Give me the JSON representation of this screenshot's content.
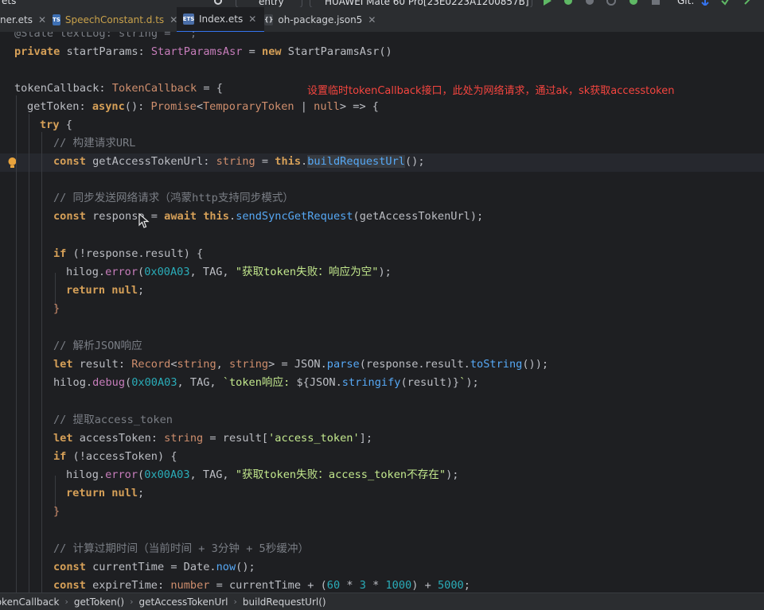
{
  "toolbar": {
    "left_fragment": "ets",
    "run_config": "entry",
    "device": "HUAWEI Mate 60 Pro[23E0223A1200857B]",
    "git_label": "Git:"
  },
  "tabs": [
    {
      "label": "ner.ets",
      "icon": "ets-file-icon",
      "active": false,
      "modified": false
    },
    {
      "label": "SpeechConstant.d.ts",
      "icon": "ts-file-icon",
      "active": false,
      "modified": true
    },
    {
      "label": "Index.ets",
      "icon": "ets-file-icon",
      "active": true,
      "modified": false
    },
    {
      "label": "oh-package.json5",
      "icon": "json-file-icon",
      "active": false,
      "modified": false
    }
  ],
  "annotation": "设置临时tokenCallback接口，此处为网络请求，通过ak，sk获取accesstoken",
  "code": {
    "l0": "@State textLog: string = '';",
    "l1a": "private",
    "l1b": " startParams: ",
    "l1c": "StartParamsAsr",
    "l1d": " = ",
    "l1e": "new",
    "l1f": " StartParamsAsr()",
    "l3a": "tokenCallback: ",
    "l3b": "TokenCallback",
    "l3c": " = {",
    "l4a": "getToken: ",
    "l4b": "async",
    "l4c": "(): ",
    "l4d": "Promise",
    "l4e": "<",
    "l4f": "TemporaryToken",
    "l4g": " | ",
    "l4h": "null",
    "l4i": "> => {",
    "l5a": "try",
    "l5b": " {",
    "l6": "// 构建请求URL",
    "l7a": "const",
    "l7b": " getAccessTokenUrl: ",
    "l7c": "string",
    "l7d": " = ",
    "l7e": "this",
    "l7f": ".",
    "l7g": "buildRequestUrl",
    "l7h": "();",
    "l9": "// 同步发送网络请求（鸿蒙http支持同步模式）",
    "l10a": "const",
    "l10b": " response = ",
    "l10c": "await",
    "l10d": " ",
    "l10e": "this",
    "l10f": ".",
    "l10g": "sendSyncGetRequest",
    "l10h": "(getAccessTokenUrl);",
    "l12a": "if",
    "l12b": " (!response.result) {",
    "l13a": "hilog.",
    "l13b": "error",
    "l13c": "(",
    "l13d": "0x00A03",
    "l13e": ", TAG, ",
    "l13f": "\"获取token失败：响应为空\"",
    "l13g": ");",
    "l14a": "return",
    "l14b": " ",
    "l14c": "null",
    "l14d": ";",
    "l15": "}",
    "l17": "// 解析JSON响应",
    "l18a": "let",
    "l18b": " result: ",
    "l18c": "Record",
    "l18d": "<",
    "l18e": "string",
    "l18f": ", ",
    "l18g": "string",
    "l18h": "> = JSON.",
    "l18i": "parse",
    "l18j": "(response.result.",
    "l18k": "toString",
    "l18l": "());",
    "l19a": "hilog.",
    "l19b": "debug",
    "l19c": "(",
    "l19d": "0x00A03",
    "l19e": ", TAG, ",
    "l19f": "`token响应: ",
    "l19g": "${JSON.",
    "l19h": "stringify",
    "l19i": "(result)}",
    "l19j": "`",
    "l19k": ");",
    "l21": "// 提取access_token",
    "l22a": "let",
    "l22b": " accessToken: ",
    "l22c": "string",
    "l22d": " = result[",
    "l22e": "'access_token'",
    "l22f": "];",
    "l23a": "if",
    "l23b": " (!accessToken) {",
    "l24a": "hilog.",
    "l24b": "error",
    "l24c": "(",
    "l24d": "0x00A03",
    "l24e": ", TAG, ",
    "l24f": "\"获取token失败：access_token不存在\"",
    "l24g": ");",
    "l25a": "return",
    "l25b": " ",
    "l25c": "null",
    "l25d": ";",
    "l26": "}",
    "l28": "// 计算过期时间（当前时间 + 3分钟 + 5秒缓冲）",
    "l29a": "const",
    "l29b": " currentTime = Date.",
    "l29c": "now",
    "l29d": "();",
    "l30a": "const",
    "l30b": " expireTime: ",
    "l30c": "number",
    "l30d": " = currentTime + (",
    "l30e": "60",
    "l30f": " * ",
    "l30g": "3",
    "l30h": " * ",
    "l30i": "1000",
    "l30j": ") + ",
    "l30k": "5000",
    "l30l": ";"
  },
  "breadcrumb": [
    "tokenCallback",
    "getToken()",
    "getAccessTokenUrl",
    "buildRequestUrl()"
  ]
}
